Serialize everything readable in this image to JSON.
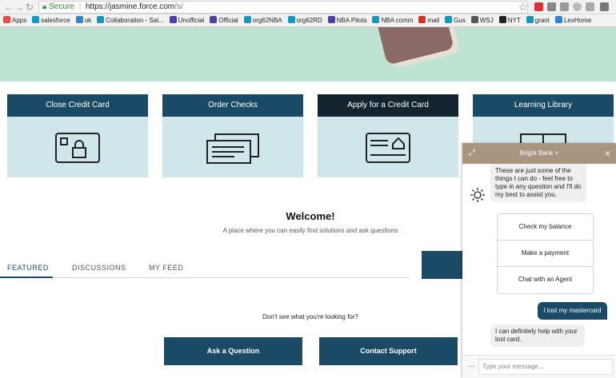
{
  "browser": {
    "secure_label": "Secure",
    "url_host": "https://jasmine.force.com",
    "url_path": "/s/",
    "bookmarks": [
      {
        "label": "Apps",
        "color": "#e0504a"
      },
      {
        "label": "salesforce",
        "color": "#1798c1"
      },
      {
        "label": "ok",
        "color": "#2f84d1"
      },
      {
        "label": "Collaboration - Sal...",
        "color": "#1798c1"
      },
      {
        "label": "Unofficial",
        "color": "#4b3fa8"
      },
      {
        "label": "Official",
        "color": "#4b3fa8"
      },
      {
        "label": "org62NBA",
        "color": "#1798c1"
      },
      {
        "label": "org62RD",
        "color": "#1798c1"
      },
      {
        "label": "NBA Pilots",
        "color": "#4b3fa8"
      },
      {
        "label": "NBA comm",
        "color": "#1798c1"
      },
      {
        "label": "mail",
        "color": "#d93025"
      },
      {
        "label": "Gus",
        "color": "#1798c1"
      },
      {
        "label": "WSJ",
        "color": "#555555"
      },
      {
        "label": "NYT",
        "color": "#222222"
      },
      {
        "label": "grant",
        "color": "#1798c1"
      },
      {
        "label": "LexHome",
        "color": "#2f84d1"
      }
    ]
  },
  "tiles": [
    {
      "title": "Close Credit Card",
      "icon": "lock-card-icon"
    },
    {
      "title": "Order Checks",
      "icon": "checks-icon"
    },
    {
      "title": "Apply for a Credit Card",
      "icon": "credit-card-icon"
    },
    {
      "title": "Learning Library",
      "icon": "book-icon"
    }
  ],
  "welcome": {
    "title": "Welcome!",
    "subtitle": "A place where you can easily find solutions and ask questions"
  },
  "tabs": [
    "FEATURED",
    "DISCUSSIONS",
    "MY FEED"
  ],
  "help": {
    "prompt": "Don't see what you're looking for?",
    "ask_label": "Ask a Question",
    "contact_label": "Contact Support"
  },
  "chat": {
    "title": "Bright Bank",
    "bot_intro": "These are just some of the things I can do - feel free to type in any question and I'll do my best to assist you.",
    "options": [
      "Check my balance",
      "Make a payment",
      "Chat with an Agent"
    ],
    "user_message": "I lost my mastercard",
    "bot_reply": "I can definitely help with your lost card.",
    "input_placeholder": "Type your message...",
    "header_color": "#a89580"
  },
  "colors": {
    "accent": "#1b4a66",
    "tile_bg": "#cfe6ea",
    "hero_bg": "#bfe3d3"
  }
}
